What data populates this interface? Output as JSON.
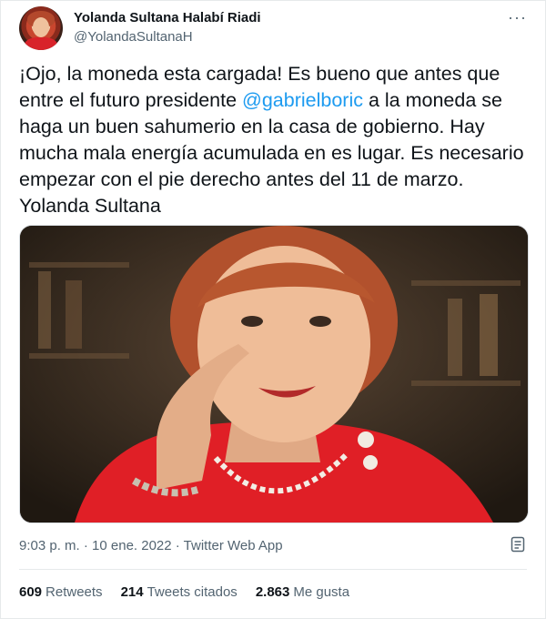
{
  "author": {
    "name": "Yolanda Sultana Halabí Riadi",
    "handle": "@YolandaSultanaH"
  },
  "more_icon": "more-dots-icon",
  "tweet": {
    "text_part1": "¡Ojo, la moneda esta cargada! Es bueno que antes que entre el futuro presidente ",
    "mention": "@gabrielboric",
    "text_part2": " a la moneda se haga un buen sahumerio en la casa de gobierno. Hay mucha mala energía acumulada en es lugar. Es necesario empezar con el pie derecho antes del 11 de marzo. Yolanda Sultana"
  },
  "meta": {
    "line": "9:03 p. m. · 10 ene. 2022 · Twitter Web App"
  },
  "stats": {
    "retweets_count": "609",
    "retweets_label": "Retweets",
    "quotes_count": "214",
    "quotes_label": "Tweets citados",
    "likes_count": "2.863",
    "likes_label": "Me gusta"
  },
  "colors": {
    "accent": "#1d9bf0",
    "text": "#0f1419",
    "secondary": "#536471"
  }
}
